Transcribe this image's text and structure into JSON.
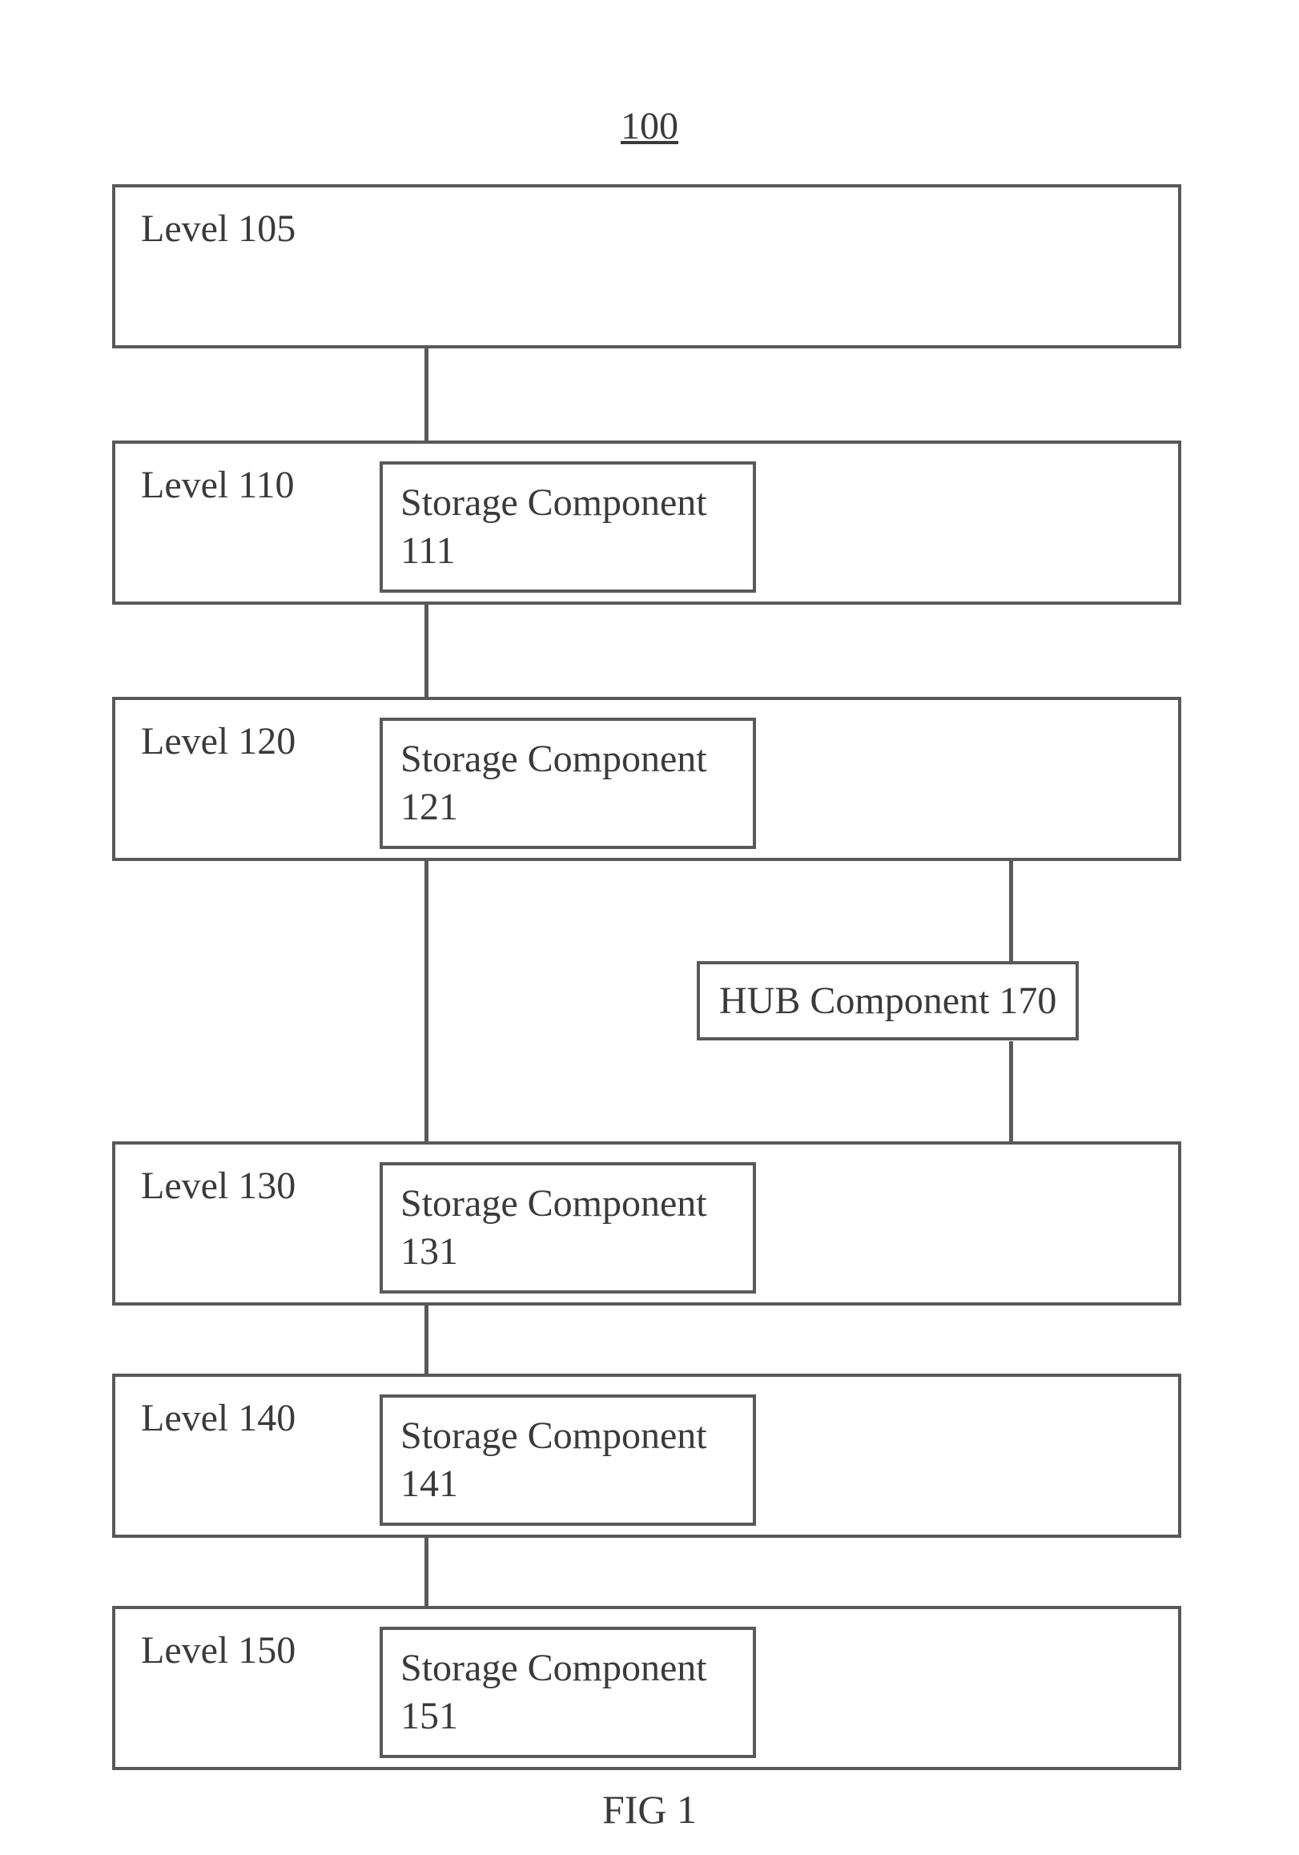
{
  "title": "100",
  "figure_caption": "FIG 1",
  "levels": [
    {
      "label": "Level 105",
      "component": null
    },
    {
      "label": "Level 110",
      "component": {
        "name": "Storage Component",
        "ref": "111"
      }
    },
    {
      "label": "Level 120",
      "component": {
        "name": "Storage Component",
        "ref": "121"
      }
    },
    {
      "label": "Level 130",
      "component": {
        "name": "Storage Component",
        "ref": "131"
      }
    },
    {
      "label": "Level 140",
      "component": {
        "name": "Storage Component",
        "ref": "141"
      }
    },
    {
      "label": "Level 150",
      "component": {
        "name": "Storage Component",
        "ref": "151"
      }
    }
  ],
  "hub": {
    "label": "HUB Component 170"
  }
}
